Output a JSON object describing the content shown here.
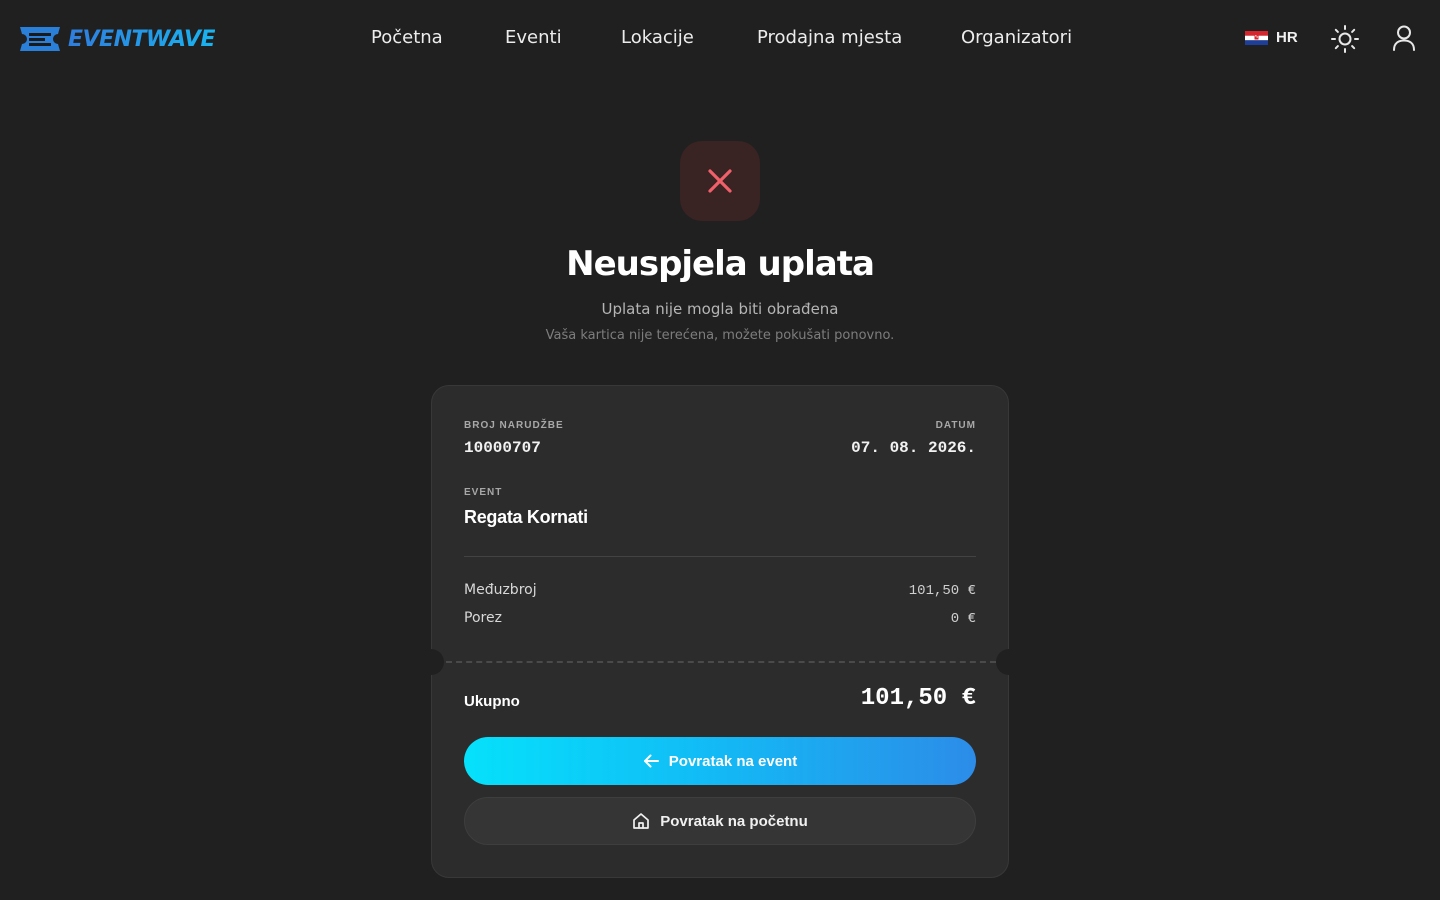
{
  "app": {
    "logo_text": "EVENTWAVE",
    "brand_color": "#19b4f0"
  },
  "nav": {
    "items": [
      {
        "label": "Početna"
      },
      {
        "label": "Eventi"
      },
      {
        "label": "Lokacije"
      },
      {
        "label": "Prodajna mjesta"
      },
      {
        "label": "Organizatori"
      }
    ]
  },
  "header_actions": {
    "language_code": "HR",
    "flag_icon": "croatia-flag-icon",
    "theme_icon": "sun-icon",
    "user_icon": "user-icon"
  },
  "status": {
    "icon": "close-icon",
    "icon_color": "#f0606a",
    "title": "Neuspjela uplata",
    "subtitle": "Uplata nije mogla biti obrađena",
    "note": "Vaša kartica nije terećena, možete pokušati ponovno."
  },
  "order": {
    "number_label": "BROJ NARUDŽBE",
    "number": "10000707",
    "date_label": "DATUM",
    "date": "07. 08. 2026.",
    "event_label": "EVENT",
    "event_name": "Regata Kornati",
    "subtotal_label": "Međuzbroj",
    "subtotal": "101,50 €",
    "tax_label": "Porez",
    "tax": "0 €",
    "total_label": "Ukupno",
    "total": "101,50 €"
  },
  "actions": {
    "back_to_event": "Povratak na event",
    "back_to_event_icon": "arrow-left-icon",
    "back_home": "Povratak na početnu",
    "back_home_icon": "home-icon"
  }
}
